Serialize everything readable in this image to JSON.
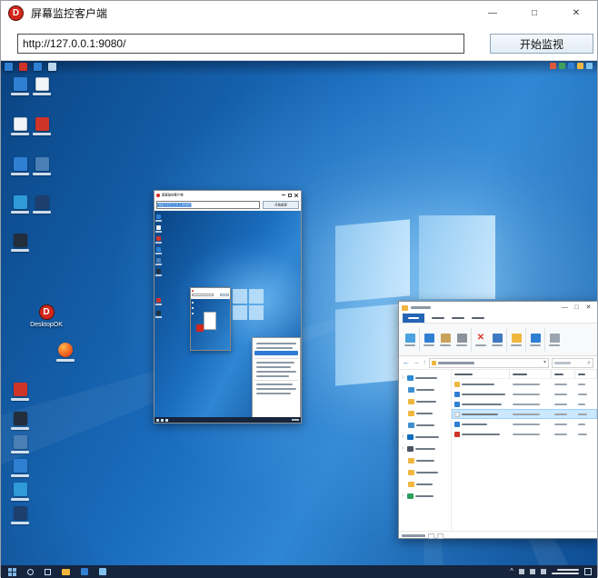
{
  "app": {
    "title": "屏幕监控客户端",
    "icon_letter": "D"
  },
  "icons": {
    "minimize": "—",
    "maximize": "□",
    "close": "✕",
    "search": "⌕",
    "back_arrow": "←",
    "forward_arrow": "→",
    "up_arrow": "↑",
    "chevron_right": "›",
    "chevron_down": "▾",
    "tray_expand": "^",
    "delete_cross": "✕"
  },
  "toolbar": {
    "url": "http://127.0.0.1:9080/",
    "start_button": "开始监视"
  },
  "remote_desktop": {
    "desktopok_label": "DesktopOK",
    "nested_client": {
      "title": "屏幕监控客户端",
      "url": "http://127.0.0.1:9080/",
      "start_button": "开始监视"
    }
  },
  "colors": {
    "accent": "#2e7cd6",
    "desktop_glow": "#7fc0ee",
    "desktop_mid": "#1a6cbd",
    "desktop_edge": "#0a4584",
    "taskbar_bg": "#16243c",
    "selection_fill": "#cce8ff",
    "selection_border": "#99d1ff",
    "button_face": "#e3ecf5",
    "button_border": "#8fa5ba",
    "explorer_ribbon": "#f8f9fa",
    "folder_yellow": "#f0b73f",
    "delete_red": "#d9382c",
    "window_border": "#9aa0a6"
  }
}
